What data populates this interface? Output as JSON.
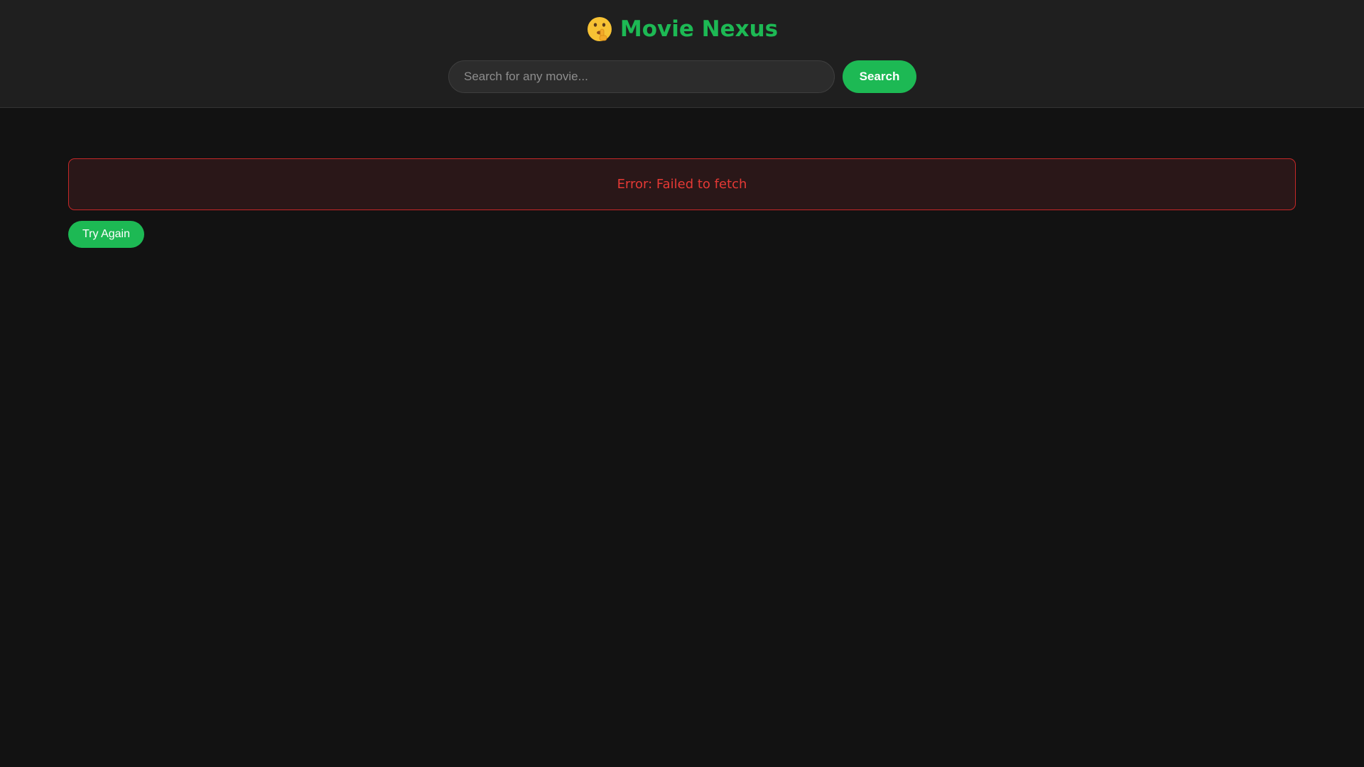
{
  "app": {
    "logo_icon": "shushing-face-icon",
    "logo_glyph": "🤫",
    "title": "Movie Nexus"
  },
  "search": {
    "placeholder": "Search for any movie...",
    "value": "",
    "button_label": "Search"
  },
  "error": {
    "message": "Error: Failed to fetch"
  },
  "actions": {
    "retry_label": "Try Again"
  },
  "colors": {
    "accent": "#1db954",
    "error_text": "#e53935",
    "error_border": "#c62828",
    "error_background": "#2a1718",
    "header_background": "#1f1f1f",
    "page_background": "#121212"
  }
}
